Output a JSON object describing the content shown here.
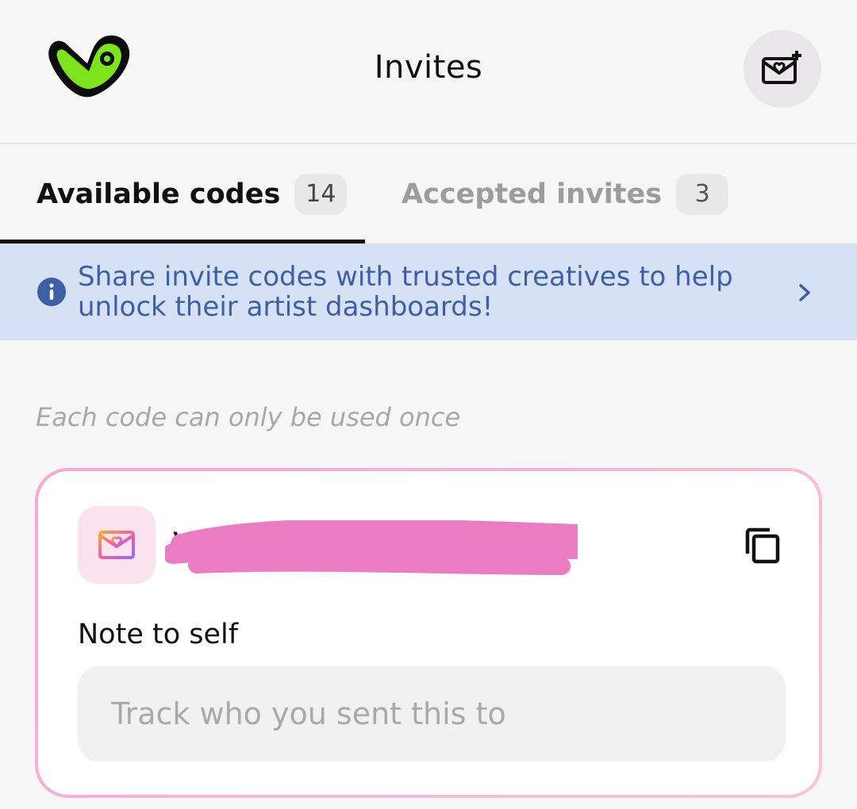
{
  "header": {
    "title": "Invites",
    "logo_icon": "brand-logo-icon",
    "action_icon": "invite-envelope-plus-icon"
  },
  "tabs": [
    {
      "label": "Available codes",
      "count": "14",
      "active": true
    },
    {
      "label": "Accepted invites",
      "count": "3",
      "active": false
    }
  ],
  "banner": {
    "text": "Share invite codes with trusted creatives to help unlock their artist dashboards!",
    "icon": "info-icon",
    "chevron": "chevron-right-icon"
  },
  "hint": "Each code can only be used once",
  "code_card": {
    "code": "VO",
    "code_icon": "heart-envelope-icon",
    "copy_icon": "copy-icon",
    "note_label": "Note to self",
    "note_placeholder": "Track who you sent this to",
    "note_value": ""
  },
  "colors": {
    "brand_green": "#7ee21c",
    "banner_bg": "#d7e1f6",
    "banner_text": "#3d5fa6",
    "card_border_pink": "#f8a7d5",
    "redaction_pink": "#ea7cc1"
  }
}
